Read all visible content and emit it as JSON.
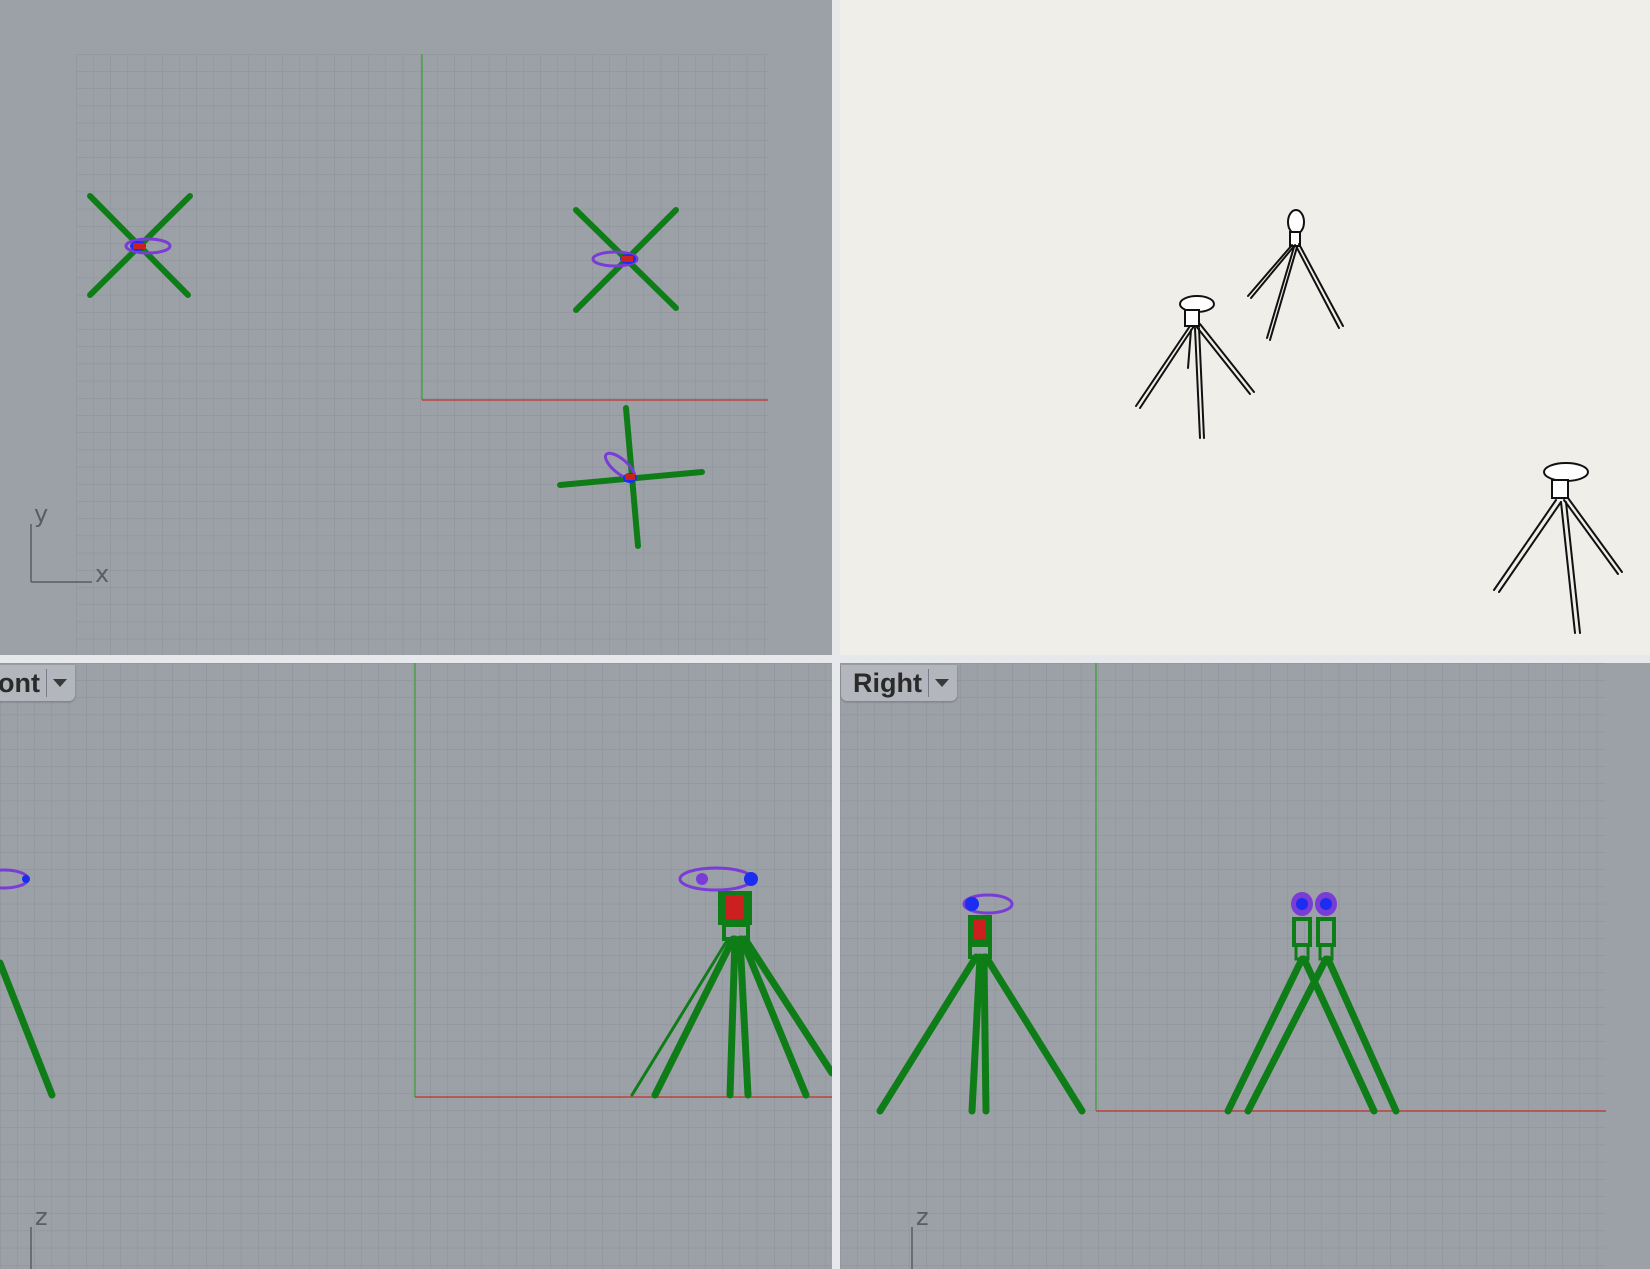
{
  "viewports": {
    "top": {
      "x_label": "x",
      "y_label": "y"
    },
    "front": {
      "title": "ont",
      "z_label": "z"
    },
    "right": {
      "title": "Right",
      "z_label": "z"
    }
  },
  "colors": {
    "viewport_bg": "#9ca0a7",
    "grid_minor": "#8d9198",
    "grid_major": "#83878e",
    "x_axis": "#b8453f",
    "y_axis": "#4aa045",
    "tripod_legs": "#0f7d17",
    "camera_body": "#7a3cd6",
    "camera_lens": "#1a2df0",
    "mount_parts": "#cc1f1f",
    "perspective_bg": "#efeee9"
  },
  "icons": {
    "viewport_menu": "chevron-down-icon"
  }
}
